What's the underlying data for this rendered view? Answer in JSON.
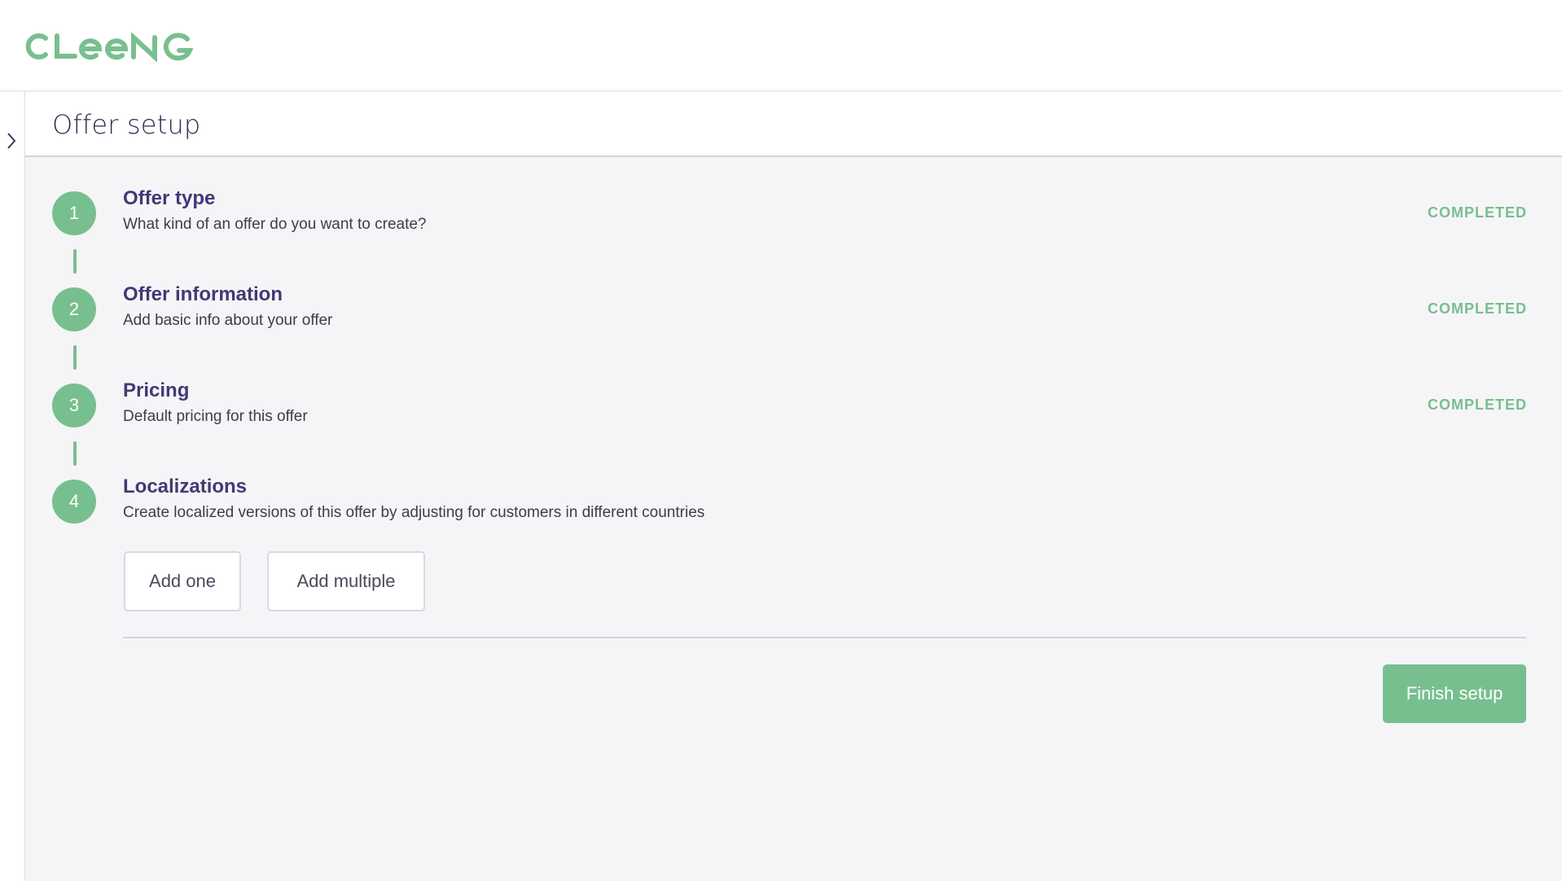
{
  "brand": {
    "logo_text": "CLEENG",
    "color": "#78bf8f"
  },
  "sidebar": {
    "toggle_icon": "chevron-right-icon"
  },
  "page": {
    "title": "Offer setup"
  },
  "steps": [
    {
      "number": "1",
      "title": "Offer type",
      "description": "What kind of an offer do you want to create?",
      "status": "COMPLETED"
    },
    {
      "number": "2",
      "title": "Offer information",
      "description": "Add basic info about your offer",
      "status": "COMPLETED"
    },
    {
      "number": "3",
      "title": "Pricing",
      "description": "Default pricing for this offer",
      "status": "COMPLETED"
    },
    {
      "number": "4",
      "title": "Localizations",
      "description": "Create localized versions of this offer by adjusting for customers in different countries",
      "status": ""
    }
  ],
  "localizations": {
    "add_one_label": "Add one",
    "add_multiple_label": "Add multiple"
  },
  "footer": {
    "finish_label": "Finish setup"
  },
  "colors": {
    "accent": "#78bf8f",
    "title": "#403a76",
    "background": "#f5f5f7"
  }
}
